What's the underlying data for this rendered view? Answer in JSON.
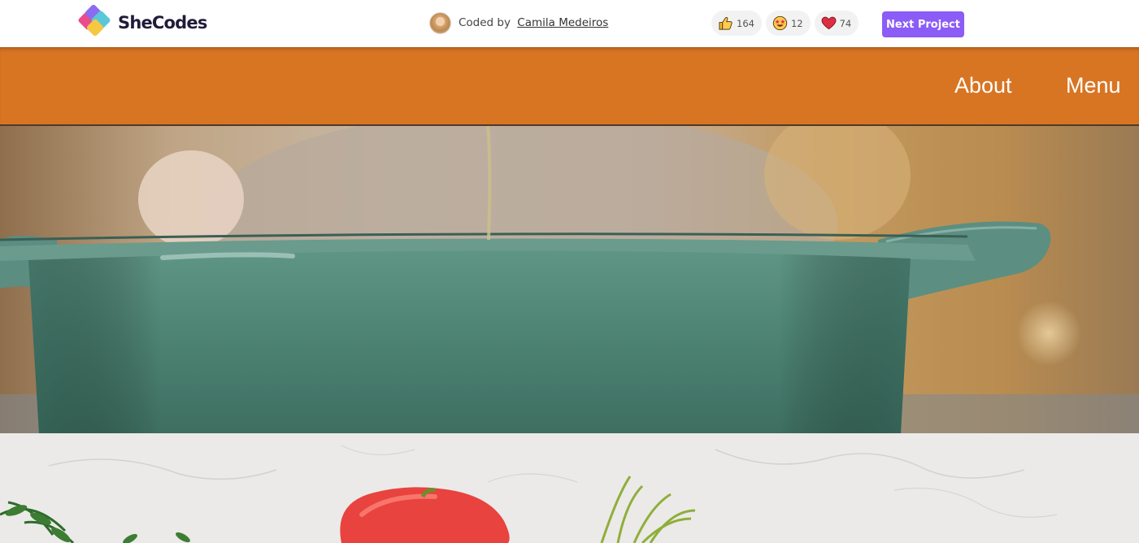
{
  "shecodes_bar": {
    "logo_text": "SheCodes",
    "coded_by_prefix": "Coded by",
    "author_name": "Camila Medeiros",
    "reactions": [
      {
        "icon": "thumbs-up-icon",
        "count": "164"
      },
      {
        "icon": "star-struck-icon",
        "count": "12"
      },
      {
        "icon": "heart-icon",
        "count": "74"
      }
    ],
    "next_project_label": "Next Project"
  },
  "site_nav": {
    "links": [
      {
        "label": "About"
      },
      {
        "label": "Menu"
      }
    ]
  },
  "colors": {
    "nav_orange": "#d87523",
    "next_button_purple": "#8b5cf6",
    "pot_teal": "#4f8877",
    "page_background": "#ebeae8"
  }
}
